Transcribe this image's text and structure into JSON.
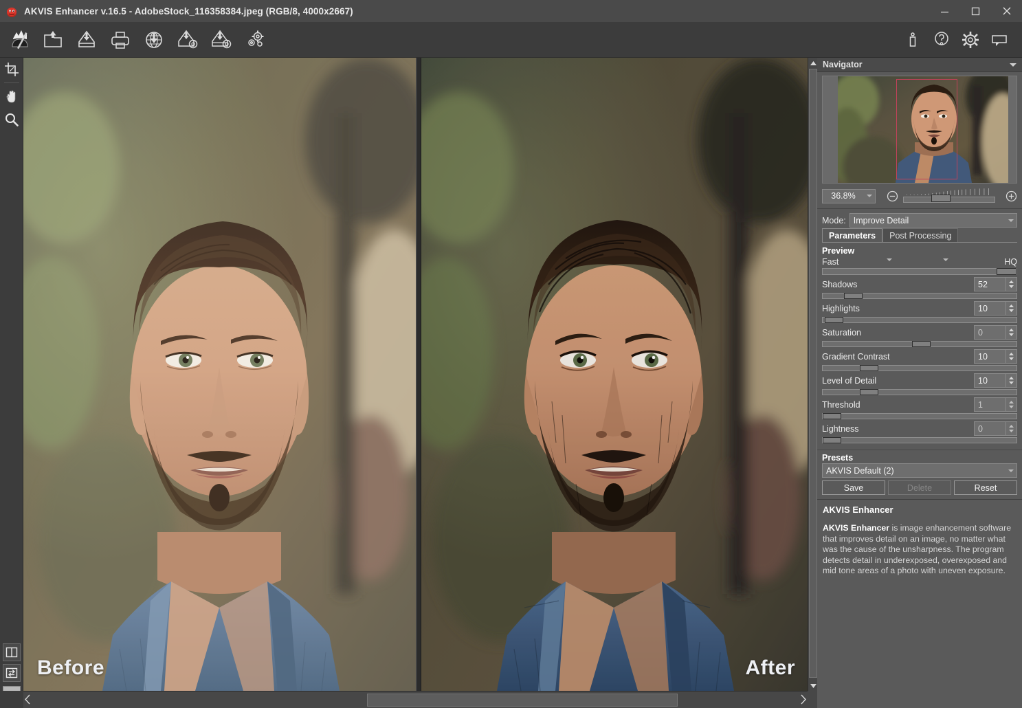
{
  "window": {
    "title": "AKVIS Enhancer v.16.5 - AdobeStock_116358384.jpeg (RGB/8, 4000x2667)",
    "logo_icon": "akvis-logo-icon",
    "minimize_label": "—",
    "maximize_label": "☐",
    "close_label": "✕"
  },
  "toolbar": {
    "left_items": [
      {
        "name": "run-icon",
        "tip": "Run"
      },
      {
        "name": "open-image-icon",
        "tip": "Open Image"
      },
      {
        "name": "save-image-icon",
        "tip": "Save Image"
      },
      {
        "name": "print-image-icon",
        "tip": "Print Image"
      },
      {
        "name": "publish-web-icon",
        "tip": "Publish"
      },
      {
        "name": "batch-open-icon",
        "tip": "Batch Open"
      },
      {
        "name": "batch-save-icon",
        "tip": "Batch Save"
      },
      {
        "name": "preferences-icon",
        "tip": "Preferences"
      }
    ],
    "right_items": [
      {
        "name": "info-icon",
        "tip": "About"
      },
      {
        "name": "help-icon",
        "tip": "Help"
      },
      {
        "name": "settings-gear-icon",
        "tip": "Settings"
      },
      {
        "name": "comment-icon",
        "tip": "Comments"
      }
    ]
  },
  "tools": {
    "items": [
      {
        "name": "crop-tool",
        "label": "Crop"
      },
      {
        "name": "hand-tool",
        "label": "Hand"
      },
      {
        "name": "zoom-tool",
        "label": "Zoom"
      }
    ],
    "bottom_items": [
      {
        "name": "split-view-toggle",
        "label": "Split View"
      },
      {
        "name": "swap-panes-toggle",
        "label": "Swap"
      }
    ],
    "color_swatch": "#b8b8b8"
  },
  "canvas": {
    "before_label": "Before",
    "after_label": "After"
  },
  "navigator": {
    "title": "Navigator",
    "collapse_icon": "chevron-down-icon",
    "zoom_value": "36.8%",
    "zoom_out_icon": "zoom-out-circle-icon",
    "zoom_in_icon": "zoom-in-circle-icon",
    "zoom_slider_percent": 30
  },
  "mode": {
    "label": "Mode:",
    "value": "Improve Detail",
    "dropdown_icon": "chevron-down-icon"
  },
  "tabs": [
    {
      "label": "Parameters",
      "active": true
    },
    {
      "label": "Post Processing",
      "active": false
    }
  ],
  "preview": {
    "title": "Preview",
    "left_label": "Fast",
    "right_label": "HQ",
    "handle_percent": 96
  },
  "parameters": [
    {
      "label": "Shadows",
      "value": "52",
      "handle_percent": 11,
      "dim": false
    },
    {
      "label": "Highlights",
      "value": "10",
      "handle_percent": 1,
      "dim": false
    },
    {
      "label": "Saturation",
      "value": "0",
      "handle_percent": 46,
      "dim": true
    },
    {
      "label": "Gradient Contrast",
      "value": "10",
      "handle_percent": 19,
      "dim": false
    },
    {
      "label": "Level of Detail",
      "value": "10",
      "handle_percent": 19,
      "dim": false
    },
    {
      "label": "Threshold",
      "value": "1",
      "handle_percent": 0,
      "dim": true
    },
    {
      "label": "Lightness",
      "value": "0",
      "handle_percent": 0,
      "dim": true
    }
  ],
  "presets": {
    "title": "Presets",
    "value": "AKVIS Default (2)",
    "dropdown_icon": "chevron-down-icon",
    "save_label": "Save",
    "delete_label": "Delete",
    "reset_label": "Reset"
  },
  "hints": {
    "title": "AKVIS Enhancer",
    "body_bold": "AKVIS Enhancer",
    "body_rest": " is image enhancement software that improves detail on an image, no matter what was the cause of the unsharpness. The program detects detail in underexposed, overexposed and mid tone areas of a photo with uneven exposure."
  },
  "colors": {
    "panel_bg": "#5a5a5a",
    "toolbar_bg": "#3c3c3c",
    "titlebar_bg": "#4a4a4a",
    "canvas_bg": "#2b2b2b",
    "accent_viewbox": "#c0425a"
  }
}
